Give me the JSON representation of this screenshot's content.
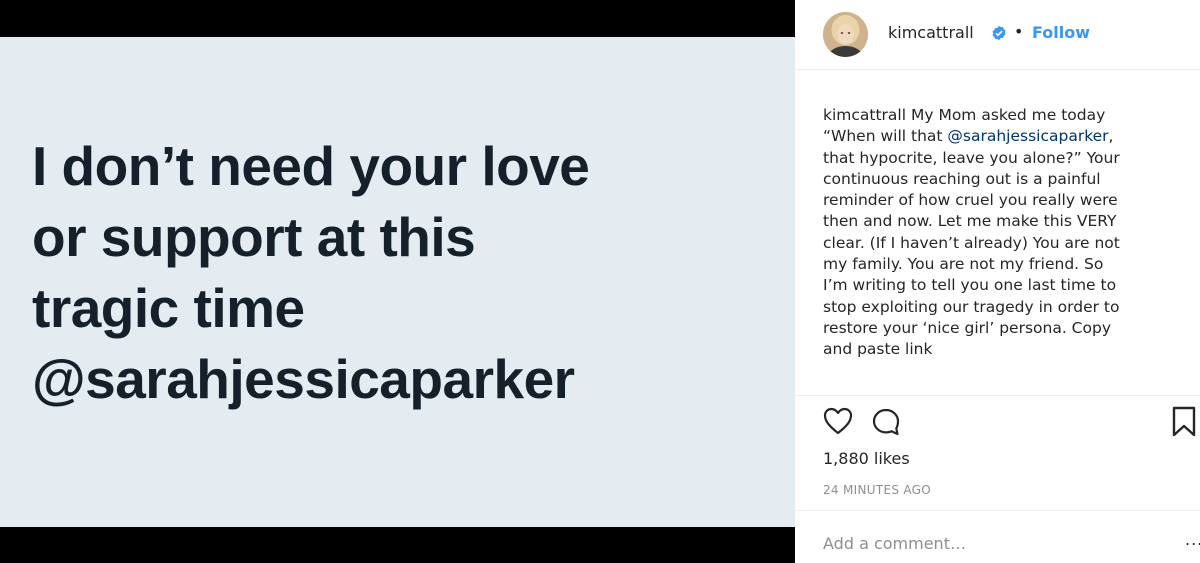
{
  "media": {
    "lines": [
      "I don’t need your love",
      "or support at this",
      "tragic time",
      "@sarahjessicaparker"
    ]
  },
  "header": {
    "username": "kimcattrall",
    "separator": "•",
    "follow_label": "Follow",
    "verified_icon": "verified-badge-icon",
    "accent_color": "#3897f0"
  },
  "caption": {
    "username": "kimcattrall",
    "line1_rest": " My Mom asked me today",
    "line2_prefix": "“When will that ",
    "mention": "@sarahjessicaparker",
    "line2_suffix": ",",
    "lines": [
      "that hypocrite, leave you alone?” Your",
      "continuous reaching out is a painful",
      "reminder of how cruel you really were",
      "then and now. Let me make this VERY",
      "clear. (If I haven’t already) You are not",
      "my family. You are not my friend. So",
      "I’m writing to tell you one last time to",
      "stop exploiting our tragedy in order to",
      "restore your ‘nice girl’ persona. Copy",
      "and paste link"
    ]
  },
  "actions": {
    "like_icon": "heart-icon",
    "comment_icon": "comment-icon",
    "save_icon": "bookmark-icon"
  },
  "likes": "1,880 likes",
  "timestamp": "24 MINUTES AGO",
  "comment": {
    "placeholder": "Add a comment…",
    "more": "..."
  }
}
